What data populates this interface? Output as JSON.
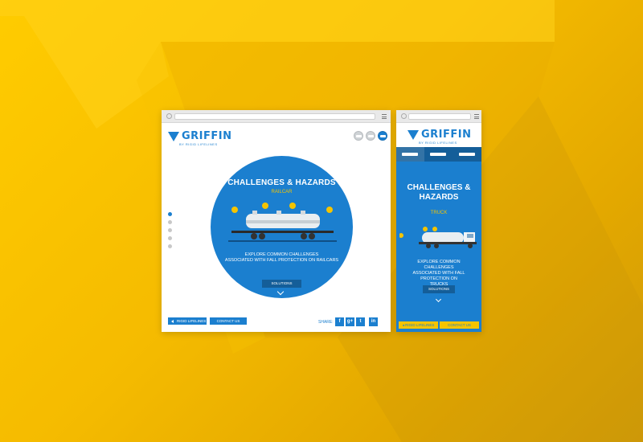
{
  "brand": {
    "name": "GRIFFIN",
    "tagline": "BY RIGID LIFELINES",
    "primary_color": "#1b7fcf",
    "accent_color": "#f5c400",
    "background_color": "#ffcc00"
  },
  "desktop": {
    "mode_icons": [
      "railcar-icon",
      "aircraft-icon",
      "truck-icon"
    ],
    "active_mode": "truck-icon",
    "hero": {
      "title": "CHALLENGES & HAZARDS",
      "subtitle": "RAILCAR",
      "description_line1": "EXPLORE COMMON CHALLENGES",
      "description_line2": "ASSOCIATED WITH FALL PROTECTION ON RAILCARS",
      "solutions_label": "SOLUTIONS"
    },
    "pagination": {
      "count": 5,
      "active_index": 0
    },
    "footer": {
      "back_label": "RIGID LIFELINES",
      "contact_label": "CONTACT US",
      "share_label": "SHARE:",
      "social": [
        "f",
        "g+",
        "t",
        "in"
      ]
    }
  },
  "mobile": {
    "tabs": [
      "truck-icon",
      "aircraft-icon",
      "railcar-icon"
    ],
    "active_tab": 0,
    "hero": {
      "title_line1": "CHALLENGES &",
      "title_line2": "HAZARDS",
      "subtitle": "TRUCK",
      "description_line1": "EXPLORE COMMON CHALLENGES",
      "description_line2": "ASSOCIATED WITH FALL PROTECTION ON",
      "description_line3": "TRUCKS",
      "solutions_label": "SOLUTIONS"
    },
    "footer": {
      "back_label": "RIGID LIFELINES",
      "contact_label": "CONTACT US"
    }
  }
}
